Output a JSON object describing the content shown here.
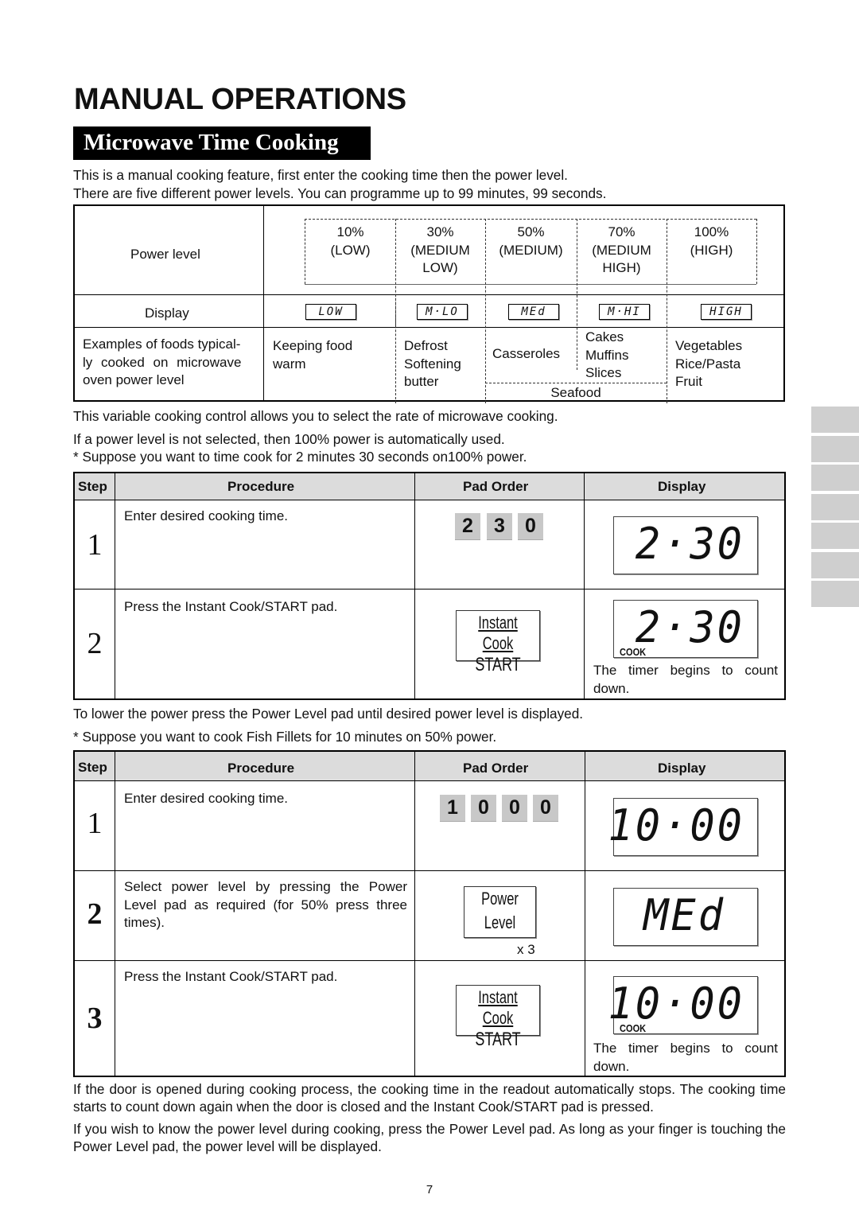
{
  "page_title": "MANUAL OPERATIONS",
  "section_title": "Microwave Time Cooking",
  "intro": [
    "This is a manual cooking feature, first enter the cooking time then the power level.",
    "There are five different power levels. You can programme up to 99 minutes, 99 seconds."
  ],
  "power_table": {
    "row_labels": {
      "power_level": "Power level",
      "display": "Display",
      "examples": [
        "Examples of foods typical-",
        "ly cooked on microwave",
        "oven power level"
      ]
    },
    "levels": [
      {
        "percent": "10%",
        "name": [
          "(LOW)"
        ],
        "display": "LOW",
        "foods": [
          "Keeping food",
          "warm"
        ]
      },
      {
        "percent": "30%",
        "name": [
          "(MEDIUM",
          "LOW)"
        ],
        "display": "M·LO",
        "foods": [
          "Defrost",
          "Softening",
          "butter"
        ]
      },
      {
        "percent": "50%",
        "name": [
          "(MEDIUM)"
        ],
        "display": "MEd",
        "foods": [
          "Casseroles"
        ]
      },
      {
        "percent": "70%",
        "name": [
          "(MEDIUM",
          "HIGH)"
        ],
        "display": "M·HI",
        "foods": [
          "Cakes",
          "Muffins",
          "Slices"
        ]
      },
      {
        "percent": "100%",
        "name": [
          "(HIGH)"
        ],
        "display": "HIGH",
        "foods": [
          "Vegetables",
          "Rice/Pasta",
          "Fruit"
        ]
      }
    ],
    "shared_food": "Seafood"
  },
  "after_table": [
    "This variable cooking control allows you to select the rate of microwave cooking.",
    "If a power level is not selected, then 100% power is automatically used.",
    "* Suppose you want to time cook for 2 minutes 30 seconds on100% power."
  ],
  "table_headers": {
    "step": "Step",
    "procedure": "Procedure",
    "pad_order": "Pad Order",
    "display": "Display"
  },
  "example1": {
    "steps": [
      {
        "num": "1",
        "procedure": "Enter desired cooking time.",
        "keys": [
          "2",
          "3",
          "0"
        ],
        "display": "2·30",
        "cook_indicator": ""
      },
      {
        "num": "2",
        "procedure": "Press the Instant Cook/START pad.",
        "pad": {
          "top": "Instant Cook",
          "bottom": "START"
        },
        "display": "2·30",
        "cook_indicator": "COOK",
        "note": "The timer begins to count down."
      }
    ]
  },
  "between_tables": [
    "To lower the power press the Power Level pad until desired power level is displayed.",
    "* Suppose you want to cook Fish Fillets for 10 minutes on 50% power."
  ],
  "example2": {
    "steps": [
      {
        "num": "1",
        "procedure": "Enter desired cooking time.",
        "keys": [
          "1",
          "0",
          "0",
          "0"
        ],
        "display": "10·00",
        "cook_indicator": ""
      },
      {
        "num": "2",
        "procedure": "Select power level by pressing the Power Level pad as required (for 50% press three times).",
        "pad": {
          "top": "Power",
          "bottom": "Level"
        },
        "multiplier": "x 3",
        "display": "MEd",
        "cook_indicator": ""
      },
      {
        "num": "3",
        "procedure": "Press the Instant Cook/START pad.",
        "pad": {
          "top": "Instant Cook",
          "bottom": "START"
        },
        "display": "10·00",
        "cook_indicator": "COOK",
        "note": "The timer begins to count down."
      }
    ]
  },
  "closing": [
    "If the door is opened during cooking process, the cooking time in the readout automatically stops. The cooking time starts to count down again when the door is closed and the Instant Cook/START pad is pressed.",
    "If you wish to know the power level during cooking, press the Power Level pad. As long as your finger is touching the Power Level pad, the power level will be displayed."
  ],
  "page_number": "7",
  "side_tab_count": 7
}
